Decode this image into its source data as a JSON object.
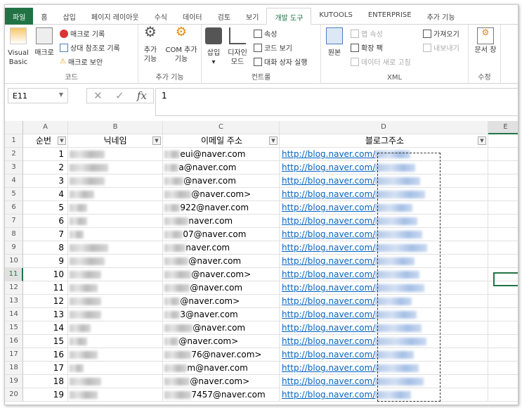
{
  "tabs": [
    "파일",
    "홈",
    "삽입",
    "페이지 레이아웃",
    "수식",
    "데이터",
    "검토",
    "보기",
    "개발 도구",
    "KUTOOLS",
    "ENTERPRISE",
    "추가 기능"
  ],
  "ribbon": {
    "code": {
      "visual_basic": "Visual Basic",
      "macro": "매크로",
      "record": "매크로 기록",
      "relative": "상대 참조로 기록",
      "security": "매크로 보안",
      "label": "코드"
    },
    "addins": {
      "addins": "추가 기능",
      "com": "COM 추가 기능",
      "label": "추가 기능"
    },
    "controls": {
      "insert": "삽입",
      "design": "디자인 모드",
      "properties": "속성",
      "view_code": "코드 보기",
      "dialog": "대화 상자 실행",
      "label": "컨트롤"
    },
    "xml": {
      "source": "원본",
      "map_props": "맵 속성",
      "expansion": "확장 팩",
      "refresh": "데이터 새로 고침",
      "import": "가져오기",
      "export": "내보내기",
      "label": "XML"
    },
    "modify": {
      "doc_panel": "문서 창",
      "label": "수정"
    }
  },
  "formula_bar": {
    "name_box": "E11",
    "value": "1"
  },
  "columns": [
    "A",
    "B",
    "C",
    "D",
    "E"
  ],
  "headers": [
    "순번",
    "닉네임",
    "이메일 주소",
    "블로그주소"
  ],
  "link_prefix": "http://blog.naver.com/",
  "rows": [
    {
      "n": "1",
      "email": "eui@naver.com"
    },
    {
      "n": "2",
      "email": "a@naver.com"
    },
    {
      "n": "3",
      "email": "@naver.com"
    },
    {
      "n": "4",
      "email": "@naver.com>"
    },
    {
      "n": "5",
      "email": "922@naver.com"
    },
    {
      "n": "6",
      "email": "naver.com"
    },
    {
      "n": "7",
      "email": "07@naver.com"
    },
    {
      "n": "8",
      "email": "naver.com"
    },
    {
      "n": "9",
      "email": "@naver.com"
    },
    {
      "n": "10",
      "email": "@naver.com>"
    },
    {
      "n": "11",
      "email": "@naver.com"
    },
    {
      "n": "12",
      "email": "@naver.com>"
    },
    {
      "n": "13",
      "email": "3@naver.com"
    },
    {
      "n": "14",
      "email": "@naver.com"
    },
    {
      "n": "15",
      "email": "@naver.com>"
    },
    {
      "n": "16",
      "email": "76@naver.com>"
    },
    {
      "n": "17",
      "email": "m@naver.com"
    },
    {
      "n": "18",
      "email": "@naver.com>"
    },
    {
      "n": "19",
      "email": "7457@naver.com"
    }
  ],
  "colors": {
    "accent": "#217346",
    "link": "#0563c1"
  }
}
